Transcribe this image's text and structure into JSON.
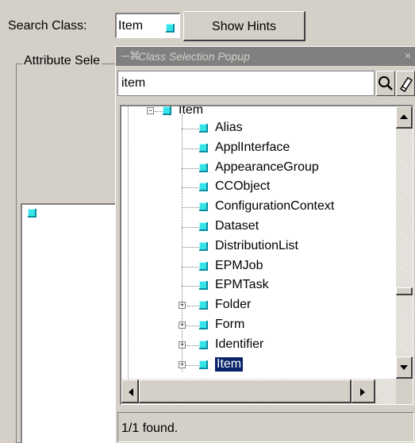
{
  "search": {
    "label": "Search Class:",
    "class_value": "Item",
    "hints_button": "Show Hints"
  },
  "panel": {
    "group_label": "Attribute Sele"
  },
  "popup": {
    "title": "Class Selection Popup",
    "search_value": "item",
    "tree_root": "Item",
    "tree_children": [
      "Alias",
      "ApplInterface",
      "AppearanceGroup",
      "CCObject",
      "ConfigurationContext",
      "Dataset",
      "DistributionList",
      "EPMJob",
      "EPMTask",
      "Folder",
      "Form",
      "Identifier",
      "Item"
    ],
    "selected_item": "Item",
    "status_text": "1/1 found."
  },
  "colors": {
    "cube": "#35e3e9",
    "selection": "#0a246a",
    "titlebar": "#808080",
    "window": "#d4d0c8"
  },
  "icons": {
    "class": "cube-icon",
    "search": "magnifier-icon",
    "clear": "eraser-icon",
    "pin": "pin-icon",
    "close": "close-icon"
  }
}
